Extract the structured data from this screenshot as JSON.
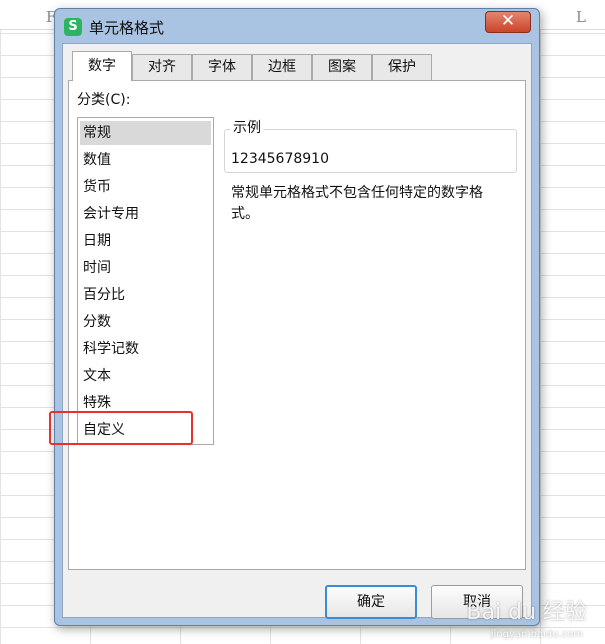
{
  "sheet": {
    "col_left": "F",
    "col_right": "L"
  },
  "dialog": {
    "title": "单元格格式",
    "app_icon_glyph": "S",
    "close_glyph": "✕",
    "tabs": [
      {
        "label": "数字",
        "active": true
      },
      {
        "label": "对齐"
      },
      {
        "label": "字体"
      },
      {
        "label": "边框"
      },
      {
        "label": "图案"
      },
      {
        "label": "保护"
      }
    ],
    "category_label": "分类(C):",
    "categories": [
      "常规",
      "数值",
      "货币",
      "会计专用",
      "日期",
      "时间",
      "百分比",
      "分数",
      "科学记数",
      "文本",
      "特殊",
      "自定义"
    ],
    "selected_category": "常规",
    "highlighted_category": "自定义",
    "sample_label": "示例",
    "sample_value": "12345678910",
    "description": "常规单元格格式不包含任何特定的数字格式。",
    "ok_label": "确定",
    "cancel_label": "取消"
  },
  "watermark": {
    "text": "Bai du 经验",
    "subtext": "jingyan.baidu.com"
  },
  "colors": {
    "highlight_box": "#e8312a",
    "app_icon": "#2db461",
    "close": "#c9452a"
  }
}
